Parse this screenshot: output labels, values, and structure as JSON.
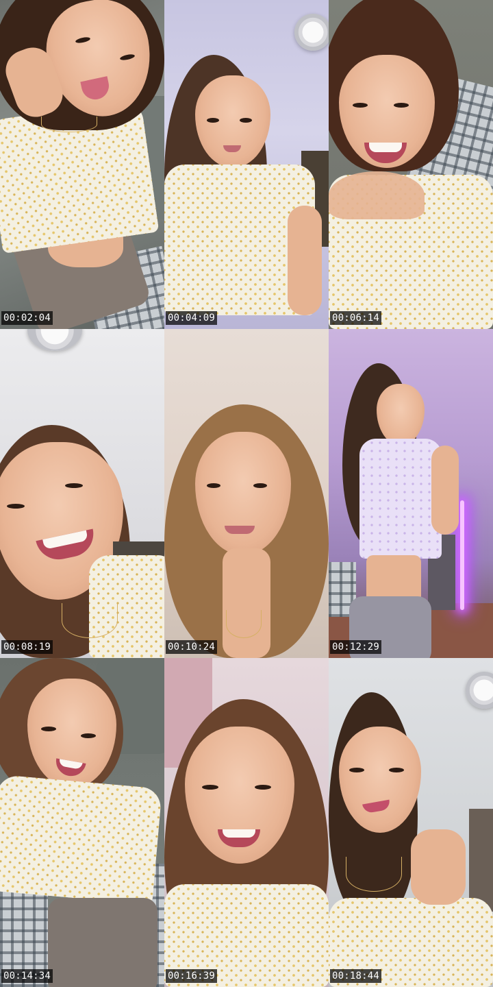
{
  "thumbnails": [
    {
      "timestamp": "00:02:04"
    },
    {
      "timestamp": "00:04:09"
    },
    {
      "timestamp": "00:06:14"
    },
    {
      "timestamp": "00:08:19"
    },
    {
      "timestamp": "00:10:24"
    },
    {
      "timestamp": "00:12:29"
    },
    {
      "timestamp": "00:14:34"
    },
    {
      "timestamp": "00:16:39"
    },
    {
      "timestamp": "00:18:44"
    }
  ],
  "colors": {
    "background": "#000000",
    "timestamp_bg": "#000000",
    "timestamp_text": "#ffffff"
  }
}
